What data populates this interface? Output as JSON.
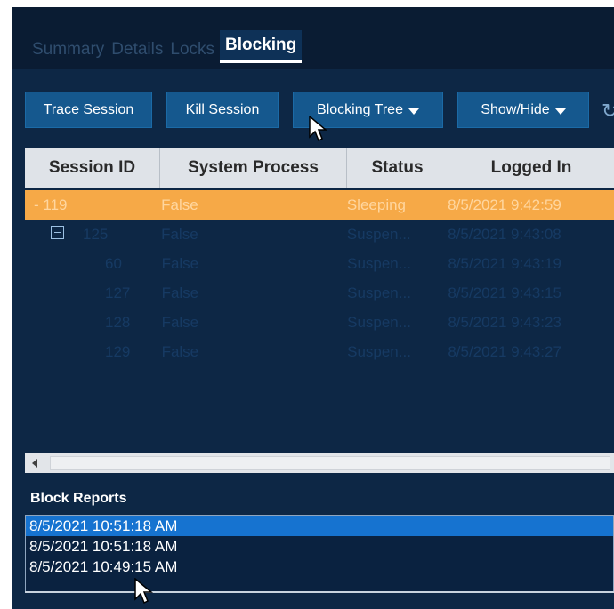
{
  "tabs": [
    {
      "label": "Summary"
    },
    {
      "label": "Details"
    },
    {
      "label": "Locks"
    },
    {
      "label": "Blocking"
    }
  ],
  "toolbar": {
    "trace": "Trace Session",
    "kill": "Kill Session",
    "blocking_tree": "Blocking Tree",
    "show_hide": "Show/Hide"
  },
  "grid": {
    "columns": [
      "Session ID",
      "System Process",
      "Status",
      "Logged In"
    ],
    "rows": [
      {
        "id": "- 119",
        "system": "False",
        "status": "Sleeping",
        "logged": "8/5/2021 9:42:59",
        "selected": true
      },
      {
        "id": "125",
        "system": "False",
        "status": "Suspen...",
        "logged": "8/5/2021 9:43:08",
        "expander": true
      },
      {
        "id": "60",
        "system": "False",
        "status": "Suspen...",
        "logged": "8/5/2021 9:43:19"
      },
      {
        "id": "127",
        "system": "False",
        "status": "Suspen...",
        "logged": "8/5/2021 9:43:15"
      },
      {
        "id": "128",
        "system": "False",
        "status": "Suspen...",
        "logged": "8/5/2021 9:43:23"
      },
      {
        "id": "129",
        "system": "False",
        "status": "Suspen...",
        "logged": "8/5/2021 9:43:27"
      }
    ]
  },
  "block_reports": {
    "title": "Block Reports",
    "items": [
      "8/5/2021 10:51:18 AM",
      "8/5/2021 10:51:18 AM",
      "8/5/2021 10:49:15 AM"
    ],
    "selected_index": 0
  },
  "colors": {
    "panel_bg": "#0d2745",
    "button_bg": "#15588e",
    "selected_row": "#f6a947",
    "selected_report": "#1673d0"
  }
}
